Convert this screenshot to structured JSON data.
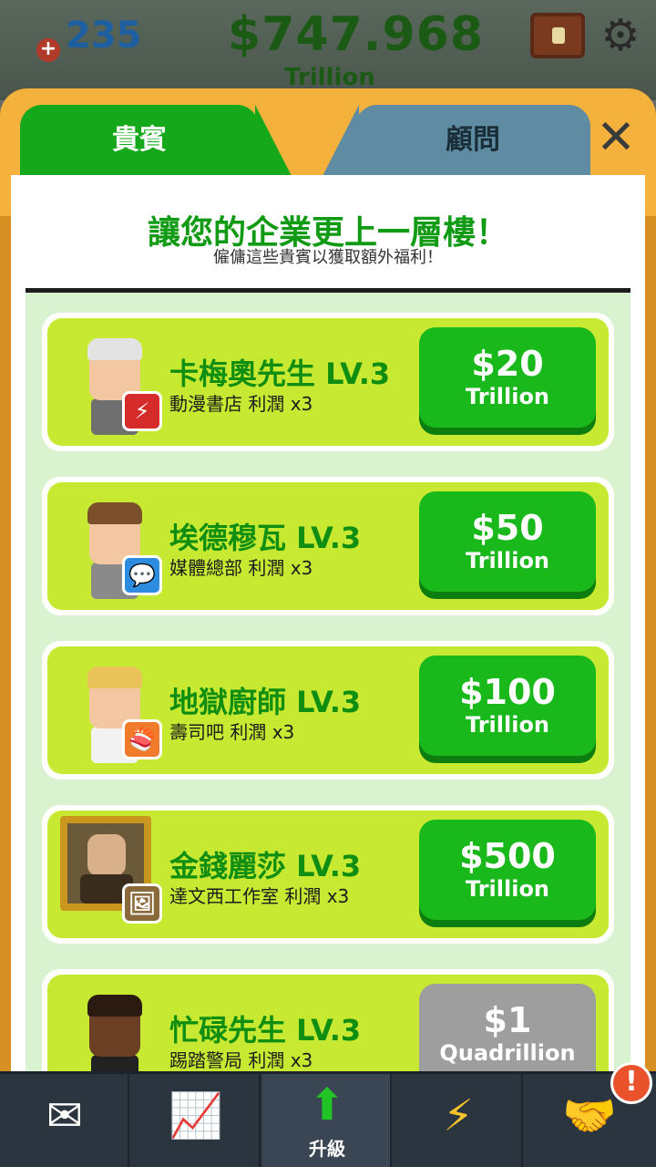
{
  "hud": {
    "level": "235",
    "money": "$747.968",
    "money_unit": "Trillion"
  },
  "tabs": [
    {
      "label": "貴賓",
      "active": true
    },
    {
      "label": "顧問",
      "active": false
    }
  ],
  "header": {
    "title": "讓您的企業更上一層樓！",
    "subtitle": "僱傭這些貴賓以獲取額外福利！"
  },
  "vips": [
    {
      "name": "卡梅奧先生 LV.3",
      "business": "動漫書店 利潤 x3",
      "price": "$20",
      "unit": "Trillion",
      "affordable": true,
      "badge_icon": "lightning-comic-icon",
      "badge_color": "#d62b2b"
    },
    {
      "name": "埃德穆瓦 LV.3",
      "business": "媒體總部 利潤 x3",
      "price": "$50",
      "unit": "Trillion",
      "affordable": true,
      "badge_icon": "chat-bubble-icon",
      "badge_color": "#2d8ce0"
    },
    {
      "name": "地獄廚師 LV.3",
      "business": "壽司吧 利潤 x3",
      "price": "$100",
      "unit": "Trillion",
      "affordable": true,
      "badge_icon": "sushi-icon",
      "badge_color": "#f07b2a"
    },
    {
      "name": "金錢麗莎 LV.3",
      "business": "達文西工作室 利潤 x3",
      "price": "$500",
      "unit": "Trillion",
      "affordable": true,
      "badge_icon": "painting-easel-icon",
      "badge_color": "#8a6a3a"
    },
    {
      "name": "忙碌先生 LV.3",
      "business": "踢踏警局 利潤 x3",
      "price": "$1",
      "unit": "Quadrillion",
      "affordable": false,
      "badge_icon": "police-badge-icon",
      "badge_color": "#3a5ca8"
    }
  ],
  "nav": [
    {
      "icon": "mail-user-icon",
      "label": ""
    },
    {
      "icon": "presentation-chart-icon",
      "label": ""
    },
    {
      "icon": "upgrade-arrow-icon",
      "label": "升級"
    },
    {
      "icon": "lightning-boost-icon",
      "label": ""
    },
    {
      "icon": "handshake-icon",
      "label": ""
    }
  ],
  "nav_alert": "!"
}
